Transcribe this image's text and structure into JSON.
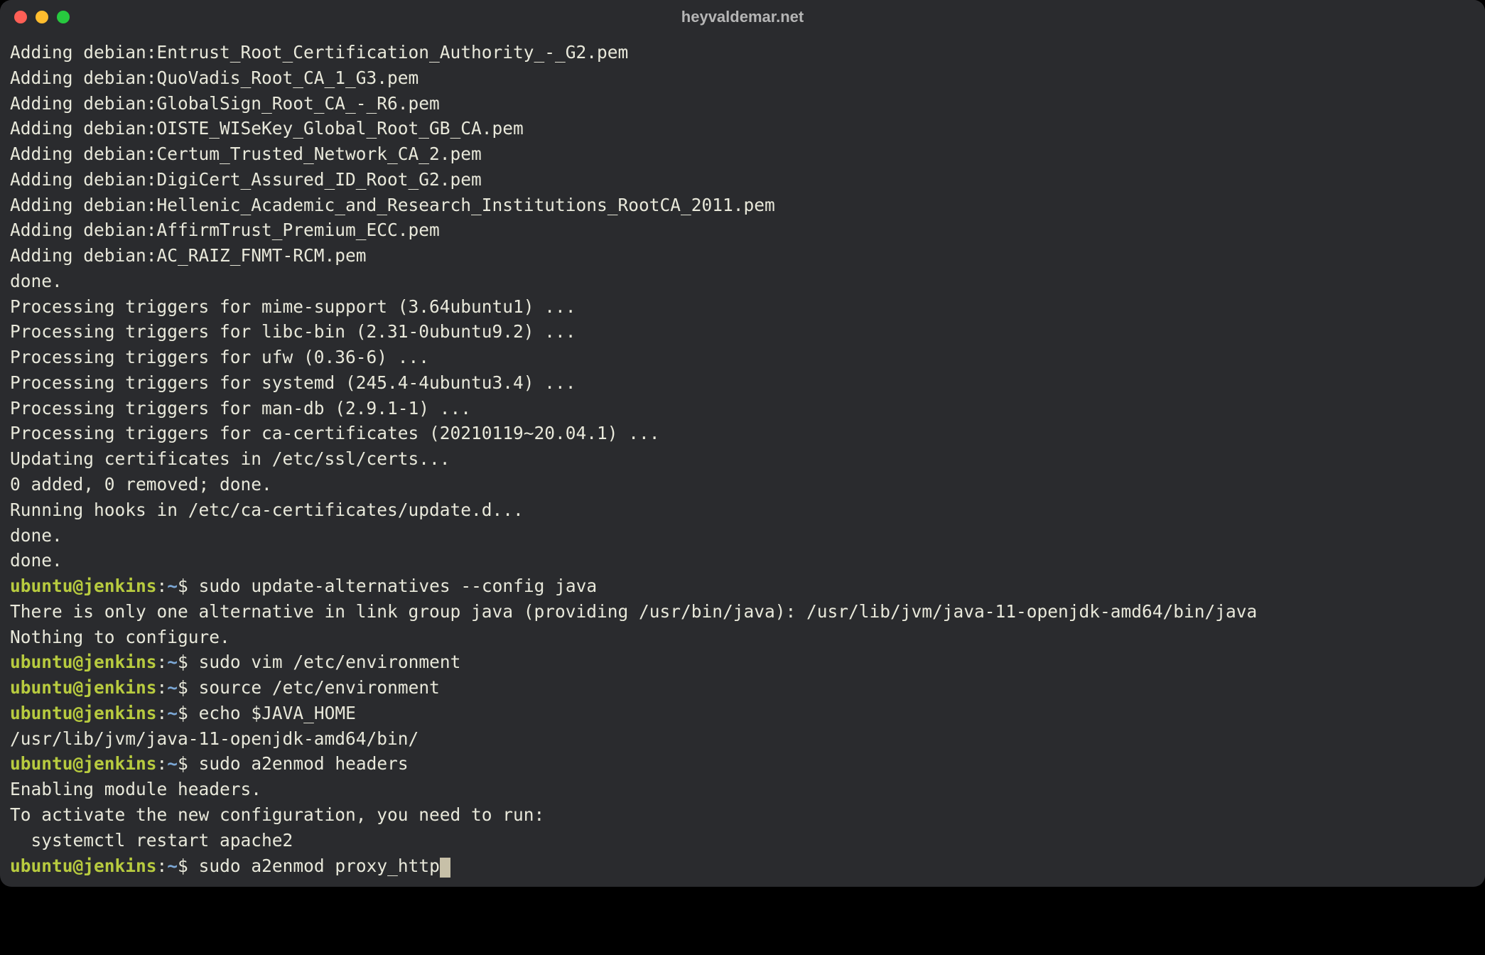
{
  "window": {
    "title": "heyvaldemar.net"
  },
  "prompt": {
    "user_host": "ubuntu@jenkins",
    "sep": ":",
    "path": "~",
    "dollar": "$"
  },
  "output": {
    "l0": "Adding debian:Entrust_Root_Certification_Authority_-_G2.pem",
    "l1": "Adding debian:QuoVadis_Root_CA_1_G3.pem",
    "l2": "Adding debian:GlobalSign_Root_CA_-_R6.pem",
    "l3": "Adding debian:OISTE_WISeKey_Global_Root_GB_CA.pem",
    "l4": "Adding debian:Certum_Trusted_Network_CA_2.pem",
    "l5": "Adding debian:DigiCert_Assured_ID_Root_G2.pem",
    "l6": "Adding debian:Hellenic_Academic_and_Research_Institutions_RootCA_2011.pem",
    "l7": "Adding debian:AffirmTrust_Premium_ECC.pem",
    "l8": "Adding debian:AC_RAIZ_FNMT-RCM.pem",
    "l9": "done.",
    "l10": "Processing triggers for mime-support (3.64ubuntu1) ...",
    "l11": "Processing triggers for libc-bin (2.31-0ubuntu9.2) ...",
    "l12": "Processing triggers for ufw (0.36-6) ...",
    "l13": "Processing triggers for systemd (245.4-4ubuntu3.4) ...",
    "l14": "Processing triggers for man-db (2.9.1-1) ...",
    "l15": "Processing triggers for ca-certificates (20210119~20.04.1) ...",
    "l16": "Updating certificates in /etc/ssl/certs...",
    "l17": "0 added, 0 removed; done.",
    "l18": "Running hooks in /etc/ca-certificates/update.d...",
    "l19": "",
    "l20": "done.",
    "l21": "done."
  },
  "cmds": {
    "c1": " sudo update-alternatives --config java",
    "r1a": "There is only one alternative in link group java (providing /usr/bin/java): /usr/lib/jvm/java-11-openjdk-amd64/bin/java",
    "r1b": "Nothing to configure.",
    "c2": " sudo vim /etc/environment",
    "c3": " source /etc/environment",
    "c4": " echo $JAVA_HOME",
    "r4": "/usr/lib/jvm/java-11-openjdk-amd64/bin/",
    "c5": " sudo a2enmod headers",
    "r5a": "Enabling module headers.",
    "r5b": "To activate the new configuration, you need to run:",
    "r5c": "  systemctl restart apache2",
    "c6": " sudo a2enmod proxy_http"
  }
}
